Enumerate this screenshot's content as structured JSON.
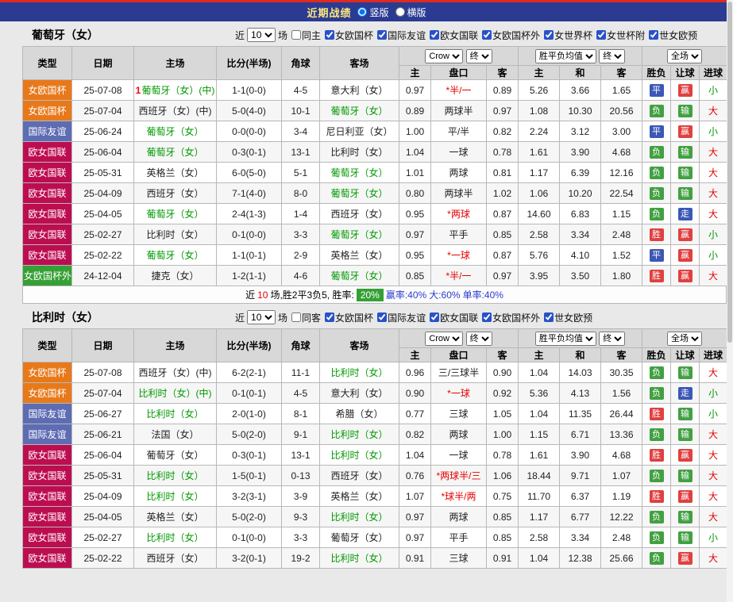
{
  "colors": {
    "topbar_bg": "#2b3b92",
    "topbar_title": "#ffe97a",
    "type_cup": "#e8791a",
    "type_friendly": "#5d6cb3",
    "type_league": "#bd0d51",
    "type_qualifier": "#35a035",
    "score_red": "#e60000",
    "team_green": "#009900",
    "badge_red": "#e04040",
    "badge_green": "#42a042",
    "badge_blue": "#3c58b5"
  },
  "topbar": {
    "title": "近期战绩",
    "options": [
      {
        "label": "竖版",
        "checked": true
      },
      {
        "label": "横版",
        "checked": false
      }
    ]
  },
  "table_header": {
    "cols": [
      "类型",
      "日期",
      "主场",
      "比分(半场)",
      "角球",
      "客场"
    ],
    "odds_select": "Crow",
    "final_select": "终",
    "avg_select": "胜平负均值",
    "full_select": "全场",
    "sub": [
      "主",
      "盘口",
      "客",
      "主",
      "和",
      "客",
      "胜负",
      "让球",
      "进球"
    ]
  },
  "sections": [
    {
      "team": "葡萄牙（女）",
      "filter": {
        "near": "近",
        "count": "10",
        "games": "场",
        "same": "同主",
        "leagues": [
          "女欧国杯",
          "国际友谊",
          "欧女国联",
          "女欧国杯外",
          "女世界杯",
          "女世杯附",
          "世女欧预"
        ]
      },
      "rows": [
        {
          "t": "女欧国杯",
          "tc": "cup",
          "d": "25-07-08",
          "hp": "1",
          "h": "葡萄牙（女）(中)",
          "hg": true,
          "s": "1-1(0-0)",
          "c": "4-5",
          "a": "意大利（女）",
          "ag": false,
          "o1": "0.97",
          "p": "*半/一",
          "pr": true,
          "o2": "0.89",
          "m1": "5.26",
          "m2": "3.66",
          "m3": "1.65",
          "r": "平",
          "rc": "blue",
          "l": "赢",
          "lc": "red",
          "g": "小",
          "gc": "green"
        },
        {
          "t": "女欧国杯",
          "tc": "cup",
          "d": "25-07-04",
          "hp": "",
          "h": "西班牙（女）(中)",
          "hg": false,
          "s": "5-0(4-0)",
          "c": "10-1",
          "a": "葡萄牙（女）",
          "ag": true,
          "o1": "0.89",
          "p": "两球半",
          "pr": false,
          "o2": "0.97",
          "m1": "1.08",
          "m2": "10.30",
          "m3": "20.56",
          "r": "负",
          "rc": "green",
          "l": "输",
          "lc": "green",
          "g": "大",
          "gc": "red"
        },
        {
          "t": "国际友谊",
          "tc": "fri",
          "d": "25-06-24",
          "hp": "",
          "h": "葡萄牙（女）",
          "hg": true,
          "s": "0-0(0-0)",
          "c": "3-4",
          "a": "尼日利亚（女）",
          "ag": false,
          "o1": "1.00",
          "p": "平/半",
          "pr": false,
          "o2": "0.82",
          "m1": "2.24",
          "m2": "3.12",
          "m3": "3.00",
          "r": "平",
          "rc": "blue",
          "l": "赢",
          "lc": "red",
          "g": "小",
          "gc": "green"
        },
        {
          "t": "欧女国联",
          "tc": "lea",
          "d": "25-06-04",
          "hp": "",
          "h": "葡萄牙（女）",
          "hg": true,
          "s": "0-3(0-1)",
          "c": "13-1",
          "a": "比利时（女）",
          "ag": false,
          "o1": "1.04",
          "p": "一球",
          "pr": false,
          "o2": "0.78",
          "m1": "1.61",
          "m2": "3.90",
          "m3": "4.68",
          "r": "负",
          "rc": "green",
          "l": "输",
          "lc": "green",
          "g": "大",
          "gc": "red"
        },
        {
          "t": "欧女国联",
          "tc": "lea",
          "d": "25-05-31",
          "hp": "",
          "h": "英格兰（女）",
          "hg": false,
          "s": "6-0(5-0)",
          "c": "5-1",
          "a": "葡萄牙（女）",
          "ag": true,
          "o1": "1.01",
          "p": "两球",
          "pr": false,
          "o2": "0.81",
          "m1": "1.17",
          "m2": "6.39",
          "m3": "12.16",
          "r": "负",
          "rc": "green",
          "l": "输",
          "lc": "green",
          "g": "大",
          "gc": "red"
        },
        {
          "t": "欧女国联",
          "tc": "lea",
          "d": "25-04-09",
          "hp": "",
          "h": "西班牙（女）",
          "hg": false,
          "s": "7-1(4-0)",
          "c": "8-0",
          "a": "葡萄牙（女）",
          "ag": true,
          "o1": "0.80",
          "p": "两球半",
          "pr": false,
          "o2": "1.02",
          "m1": "1.06",
          "m2": "10.20",
          "m3": "22.54",
          "r": "负",
          "rc": "green",
          "l": "输",
          "lc": "green",
          "g": "大",
          "gc": "red"
        },
        {
          "t": "欧女国联",
          "tc": "lea",
          "d": "25-04-05",
          "hp": "",
          "h": "葡萄牙（女）",
          "hg": true,
          "s": "2-4(1-3)",
          "c": "1-4",
          "a": "西班牙（女）",
          "ag": false,
          "o1": "0.95",
          "p": "*两球",
          "pr": true,
          "o2": "0.87",
          "m1": "14.60",
          "m2": "6.83",
          "m3": "1.15",
          "r": "负",
          "rc": "green",
          "l": "走",
          "lc": "blue",
          "g": "大",
          "gc": "red"
        },
        {
          "t": "欧女国联",
          "tc": "lea",
          "d": "25-02-27",
          "hp": "",
          "h": "比利时（女）",
          "hg": false,
          "s": "0-1(0-0)",
          "c": "3-3",
          "a": "葡萄牙（女）",
          "ag": true,
          "o1": "0.97",
          "p": "平手",
          "pr": false,
          "o2": "0.85",
          "m1": "2.58",
          "m2": "3.34",
          "m3": "2.48",
          "r": "胜",
          "rc": "red",
          "l": "赢",
          "lc": "red",
          "g": "小",
          "gc": "green"
        },
        {
          "t": "欧女国联",
          "tc": "lea",
          "d": "25-02-22",
          "hp": "",
          "h": "葡萄牙（女）",
          "hg": true,
          "s": "1-1(0-1)",
          "c": "2-9",
          "a": "英格兰（女）",
          "ag": false,
          "o1": "0.95",
          "p": "*一球",
          "pr": true,
          "o2": "0.87",
          "m1": "5.76",
          "m2": "4.10",
          "m3": "1.52",
          "r": "平",
          "rc": "blue",
          "l": "赢",
          "lc": "red",
          "g": "小",
          "gc": "green"
        },
        {
          "t": "女欧国杯外",
          "tc": "qua",
          "d": "24-12-04",
          "hp": "",
          "h": "捷克（女）",
          "hg": false,
          "s": "1-2(1-1)",
          "c": "4-6",
          "a": "葡萄牙（女）",
          "ag": true,
          "o1": "0.85",
          "p": "*半/一",
          "pr": true,
          "o2": "0.97",
          "m1": "3.95",
          "m2": "3.50",
          "m3": "1.80",
          "r": "胜",
          "rc": "red",
          "l": "赢",
          "lc": "red",
          "g": "大",
          "gc": "red"
        }
      ],
      "summary": {
        "p1": "近",
        "count": "10",
        "p2": "场,胜2平3负5, 胜率:",
        "badge": "20%",
        "p3": "赢率:40%",
        "p4": "大:60%",
        "p5": "单率:40%"
      }
    },
    {
      "team": "比利时（女）",
      "filter": {
        "near": "近",
        "count": "10",
        "games": "场",
        "same": "同客",
        "leagues": [
          "女欧国杯",
          "国际友谊",
          "欧女国联",
          "女欧国杯外",
          "世女欧预"
        ]
      },
      "rows": [
        {
          "t": "女欧国杯",
          "tc": "cup",
          "d": "25-07-08",
          "hp": "",
          "h": "西班牙（女）(中)",
          "hg": false,
          "s": "6-2(2-1)",
          "c": "11-1",
          "a": "比利时（女）",
          "ag": true,
          "o1": "0.96",
          "p": "三/三球半",
          "pr": false,
          "o2": "0.90",
          "m1": "1.04",
          "m2": "14.03",
          "m3": "30.35",
          "r": "负",
          "rc": "green",
          "l": "输",
          "lc": "green",
          "g": "大",
          "gc": "red"
        },
        {
          "t": "女欧国杯",
          "tc": "cup",
          "d": "25-07-04",
          "hp": "",
          "h": "比利时（女）(中)",
          "hg": true,
          "s": "0-1(0-1)",
          "c": "4-5",
          "a": "意大利（女）",
          "ag": false,
          "o1": "0.90",
          "p": "*一球",
          "pr": true,
          "o2": "0.92",
          "m1": "5.36",
          "m2": "4.13",
          "m3": "1.56",
          "r": "负",
          "rc": "green",
          "l": "走",
          "lc": "blue",
          "g": "小",
          "gc": "green"
        },
        {
          "t": "国际友谊",
          "tc": "fri",
          "d": "25-06-27",
          "hp": "",
          "h": "比利时（女）",
          "hg": true,
          "s": "2-0(1-0)",
          "c": "8-1",
          "a": "希腊（女）",
          "ag": false,
          "o1": "0.77",
          "p": "三球",
          "pr": false,
          "o2": "1.05",
          "m1": "1.04",
          "m2": "11.35",
          "m3": "26.44",
          "r": "胜",
          "rc": "red",
          "l": "输",
          "lc": "green",
          "g": "小",
          "gc": "green"
        },
        {
          "t": "国际友谊",
          "tc": "fri",
          "d": "25-06-21",
          "hp": "",
          "h": "法国（女）",
          "hg": false,
          "s": "5-0(2-0)",
          "c": "9-1",
          "a": "比利时（女）",
          "ag": true,
          "o1": "0.82",
          "p": "两球",
          "pr": false,
          "o2": "1.00",
          "m1": "1.15",
          "m2": "6.71",
          "m3": "13.36",
          "r": "负",
          "rc": "green",
          "l": "输",
          "lc": "green",
          "g": "大",
          "gc": "red"
        },
        {
          "t": "欧女国联",
          "tc": "lea",
          "d": "25-06-04",
          "hp": "",
          "h": "葡萄牙（女）",
          "hg": false,
          "s": "0-3(0-1)",
          "c": "13-1",
          "a": "比利时（女）",
          "ag": true,
          "o1": "1.04",
          "p": "一球",
          "pr": false,
          "o2": "0.78",
          "m1": "1.61",
          "m2": "3.90",
          "m3": "4.68",
          "r": "胜",
          "rc": "red",
          "l": "赢",
          "lc": "red",
          "g": "大",
          "gc": "red"
        },
        {
          "t": "欧女国联",
          "tc": "lea",
          "d": "25-05-31",
          "hp": "",
          "h": "比利时（女）",
          "hg": true,
          "s": "1-5(0-1)",
          "c": "0-13",
          "a": "西班牙（女）",
          "ag": false,
          "o1": "0.76",
          "p": "*两球半/三",
          "pr": true,
          "o2": "1.06",
          "m1": "18.44",
          "m2": "9.71",
          "m3": "1.07",
          "r": "负",
          "rc": "green",
          "l": "输",
          "lc": "green",
          "g": "大",
          "gc": "red"
        },
        {
          "t": "欧女国联",
          "tc": "lea",
          "d": "25-04-09",
          "hp": "",
          "h": "比利时（女）",
          "hg": true,
          "s": "3-2(3-1)",
          "c": "3-9",
          "a": "英格兰（女）",
          "ag": false,
          "o1": "1.07",
          "p": "*球半/两",
          "pr": true,
          "o2": "0.75",
          "m1": "11.70",
          "m2": "6.37",
          "m3": "1.19",
          "r": "胜",
          "rc": "red",
          "l": "赢",
          "lc": "red",
          "g": "大",
          "gc": "red"
        },
        {
          "t": "欧女国联",
          "tc": "lea",
          "d": "25-04-05",
          "hp": "",
          "h": "英格兰（女）",
          "hg": false,
          "s": "5-0(2-0)",
          "c": "9-3",
          "a": "比利时（女）",
          "ag": true,
          "o1": "0.97",
          "p": "两球",
          "pr": false,
          "o2": "0.85",
          "m1": "1.17",
          "m2": "6.77",
          "m3": "12.22",
          "r": "负",
          "rc": "green",
          "l": "输",
          "lc": "green",
          "g": "大",
          "gc": "red"
        },
        {
          "t": "欧女国联",
          "tc": "lea",
          "d": "25-02-27",
          "hp": "",
          "h": "比利时（女）",
          "hg": true,
          "s": "0-1(0-0)",
          "c": "3-3",
          "a": "葡萄牙（女）",
          "ag": false,
          "o1": "0.97",
          "p": "平手",
          "pr": false,
          "o2": "0.85",
          "m1": "2.58",
          "m2": "3.34",
          "m3": "2.48",
          "r": "负",
          "rc": "green",
          "l": "输",
          "lc": "green",
          "g": "小",
          "gc": "green"
        },
        {
          "t": "欧女国联",
          "tc": "lea",
          "d": "25-02-22",
          "hp": "",
          "h": "西班牙（女）",
          "hg": false,
          "s": "3-2(0-1)",
          "c": "19-2",
          "a": "比利时（女）",
          "ag": true,
          "o1": "0.91",
          "p": "三球",
          "pr": false,
          "o2": "0.91",
          "m1": "1.04",
          "m2": "12.38",
          "m3": "25.66",
          "r": "负",
          "rc": "green",
          "l": "赢",
          "lc": "red",
          "g": "大",
          "gc": "red"
        }
      ]
    }
  ]
}
